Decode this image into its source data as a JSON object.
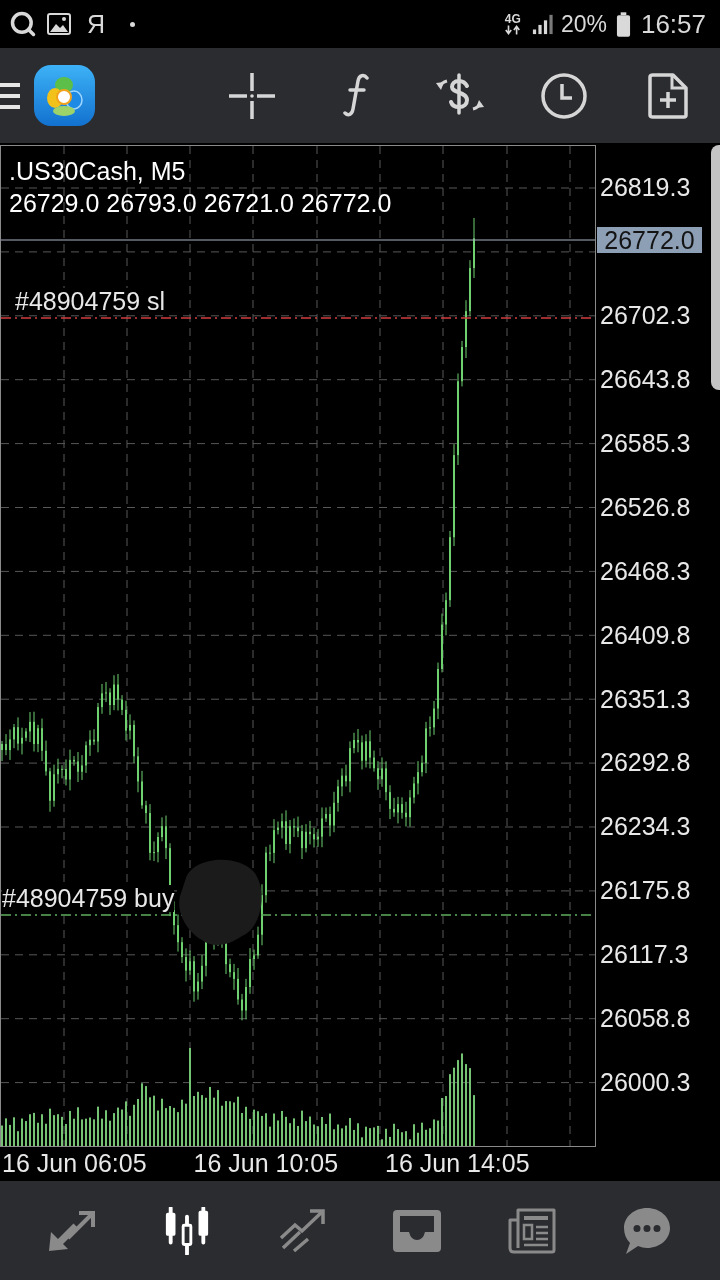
{
  "status_bar": {
    "app_letter": "Я",
    "network": "4G",
    "battery": "20%",
    "time": "16:57"
  },
  "chart": {
    "symbol": ".US30Cash, M5",
    "ohlc": "26729.0 26793.0 26721.0 26772.0",
    "current_price": "26772.0",
    "orders": [
      {
        "kind": "sl",
        "label": "#48904759 sl"
      },
      {
        "kind": "buy",
        "label": "#48904759 buy"
      }
    ],
    "price_axis": [
      "26819.3",
      "26702.3",
      "26643.8",
      "26585.3",
      "26526.8",
      "26468.3",
      "26409.8",
      "26351.3",
      "26292.8",
      "26234.3",
      "26175.8",
      "26117.3",
      "26058.8",
      "26000.3"
    ],
    "time_axis": [
      "16 Jun 06:05",
      "16 Jun 10:05",
      "16 Jun 14:05"
    ]
  },
  "bottom_nav": [
    {
      "selected": false
    },
    {
      "selected": true
    },
    {
      "selected": false
    },
    {
      "selected": false
    },
    {
      "selected": false
    },
    {
      "selected": false
    }
  ]
}
